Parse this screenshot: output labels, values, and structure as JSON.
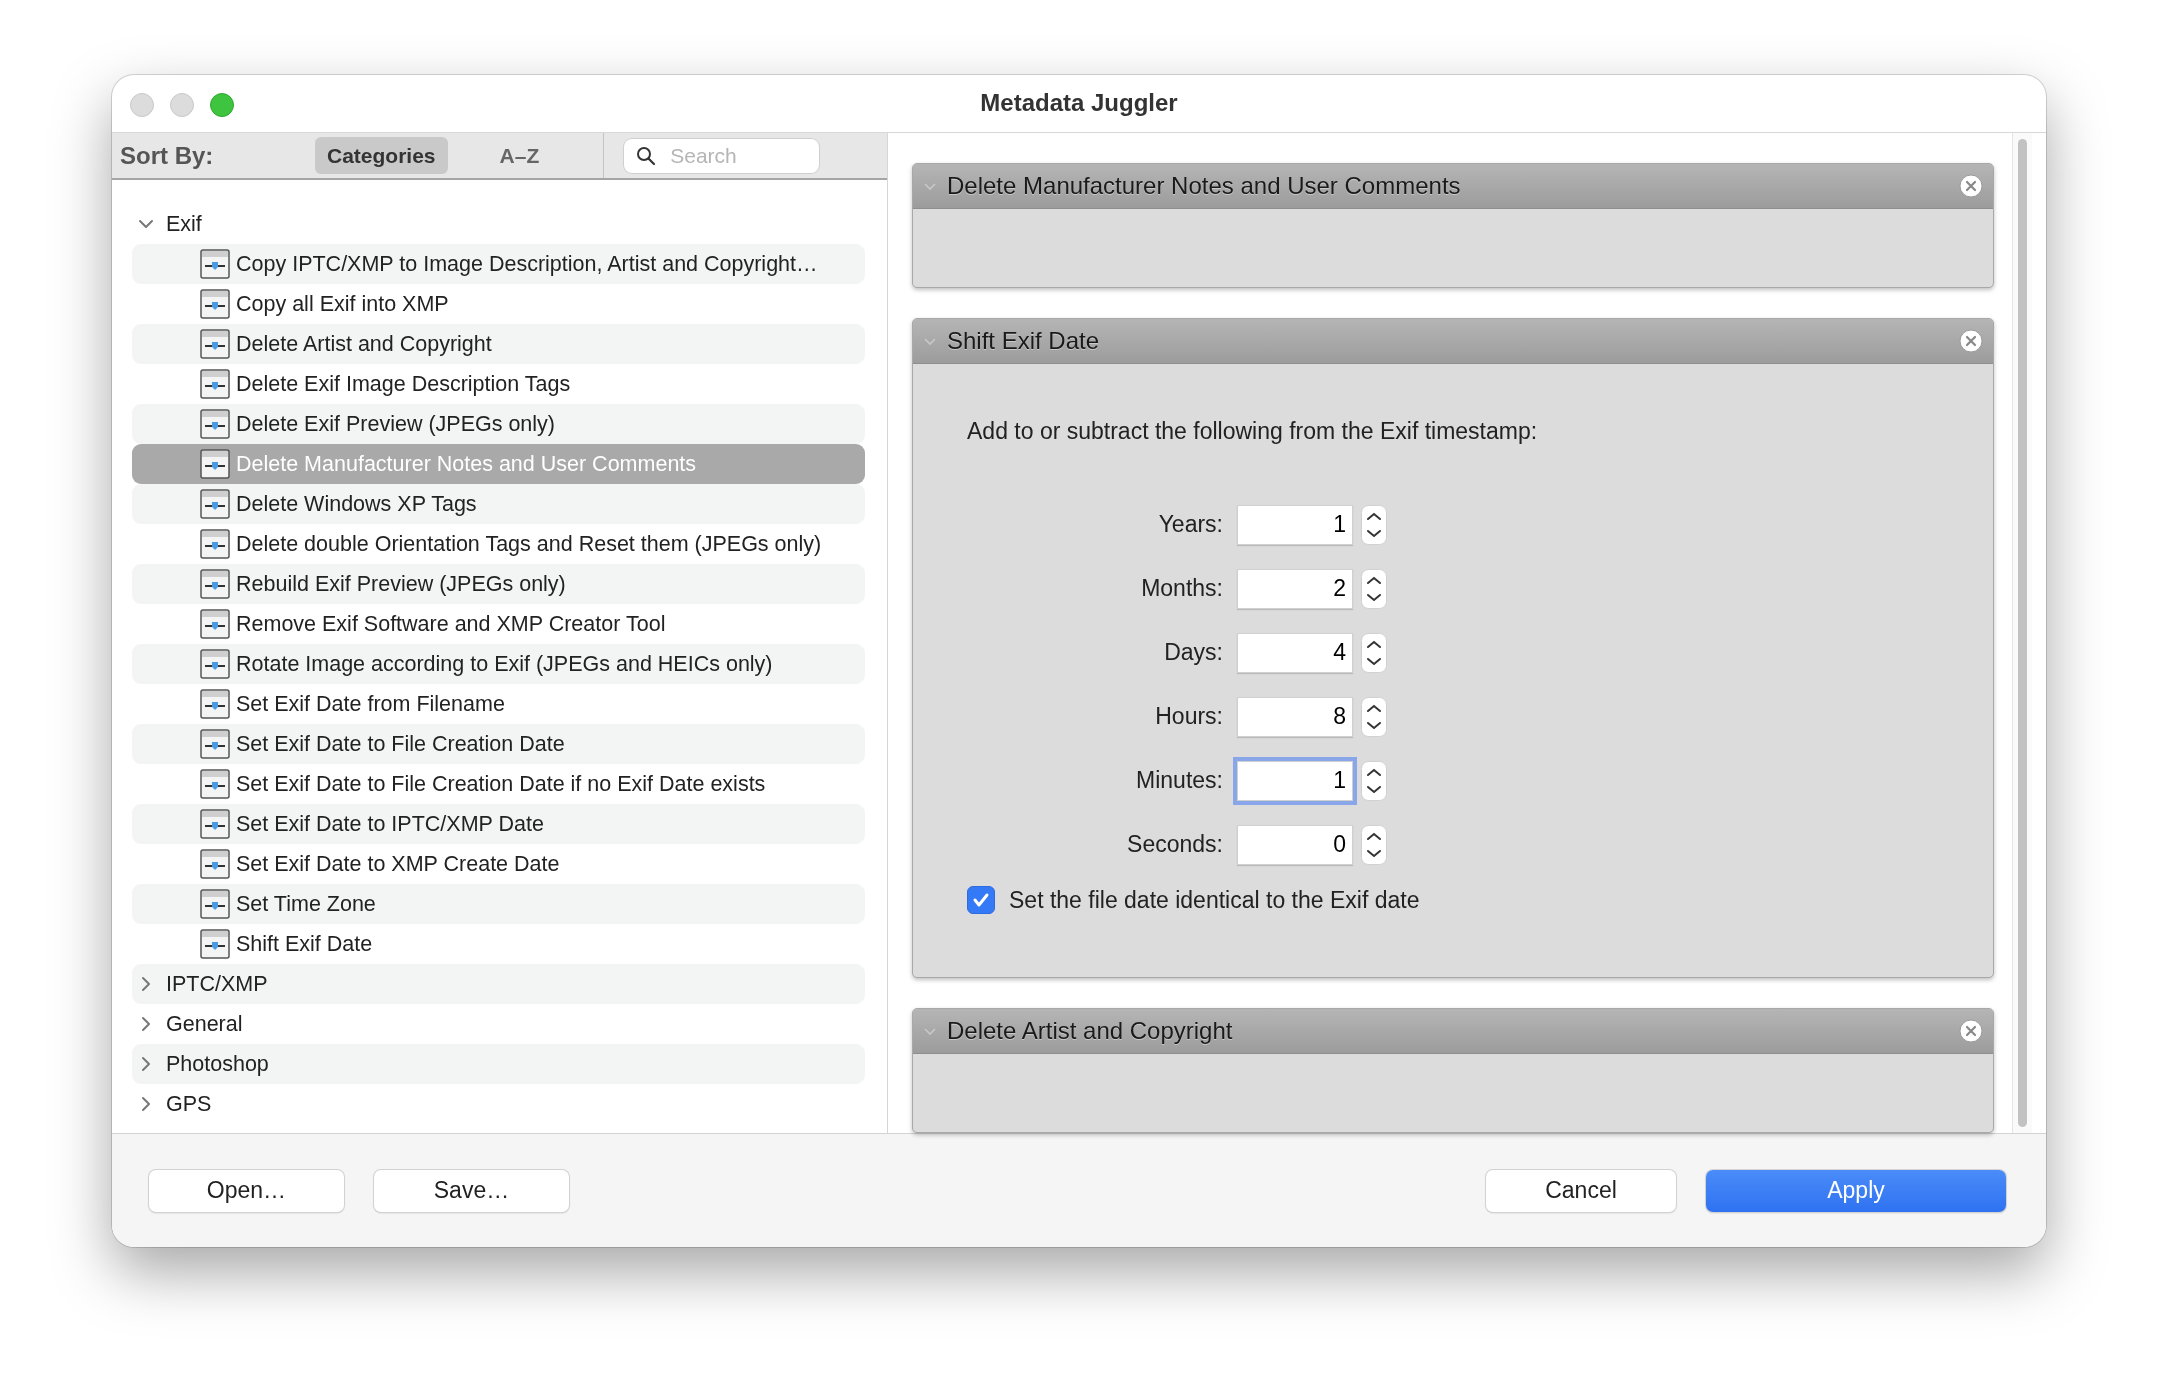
{
  "window": {
    "title": "Metadata Juggler"
  },
  "sort_bar": {
    "label": "Sort By:",
    "options": [
      {
        "label": "Categories",
        "selected": true
      },
      {
        "label": "A–Z",
        "selected": false
      }
    ],
    "search": {
      "placeholder": "Search"
    }
  },
  "tree": [
    {
      "label": "Exif",
      "expanded": true,
      "children": [
        {
          "label": "Copy IPTC/XMP to Image Description, Artist and Copyright…",
          "selected": false
        },
        {
          "label": "Copy all Exif into XMP",
          "selected": false
        },
        {
          "label": "Delete Artist and Copyright",
          "selected": false
        },
        {
          "label": "Delete Exif Image Description Tags",
          "selected": false
        },
        {
          "label": "Delete Exif Preview (JPEGs only)",
          "selected": false
        },
        {
          "label": "Delete Manufacturer Notes and User Comments",
          "selected": true
        },
        {
          "label": "Delete Windows XP Tags",
          "selected": false
        },
        {
          "label": "Delete double Orientation Tags and Reset them (JPEGs only)",
          "selected": false
        },
        {
          "label": "Rebuild Exif Preview (JPEGs only)",
          "selected": false
        },
        {
          "label": "Remove Exif Software and XMP Creator Tool",
          "selected": false
        },
        {
          "label": "Rotate Image according to Exif (JPEGs and HEICs only)",
          "selected": false
        },
        {
          "label": "Set Exif Date from Filename",
          "selected": false
        },
        {
          "label": "Set Exif Date to File Creation Date",
          "selected": false
        },
        {
          "label": "Set Exif Date to File Creation Date if no Exif Date exists",
          "selected": false
        },
        {
          "label": "Set Exif Date to IPTC/XMP Date",
          "selected": false
        },
        {
          "label": "Set Exif Date to XMP Create Date",
          "selected": false
        },
        {
          "label": "Set Time Zone",
          "selected": false
        },
        {
          "label": "Shift Exif Date",
          "selected": false
        }
      ]
    },
    {
      "label": "IPTC/XMP",
      "expanded": false
    },
    {
      "label": "General",
      "expanded": false
    },
    {
      "label": "Photoshop",
      "expanded": false
    },
    {
      "label": "GPS",
      "expanded": false
    }
  ],
  "actions": [
    {
      "title": "Delete Manufacturer Notes and User Comments",
      "kind": "empty"
    },
    {
      "title": "Shift Exif Date",
      "kind": "shift_date",
      "instruction": "Add to or subtract the following from the Exif timestamp:",
      "fields": [
        {
          "label": "Years:",
          "value": "1",
          "focused": false
        },
        {
          "label": "Months:",
          "value": "2",
          "focused": false
        },
        {
          "label": "Days:",
          "value": "4",
          "focused": false
        },
        {
          "label": "Hours:",
          "value": "8",
          "focused": false
        },
        {
          "label": "Minutes:",
          "value": "1",
          "focused": true
        },
        {
          "label": "Seconds:",
          "value": "0",
          "focused": false
        }
      ],
      "checkbox": {
        "label": "Set the file date identical to the Exif date",
        "checked": true
      }
    },
    {
      "title": "Delete Artist and Copyright",
      "kind": "empty"
    }
  ],
  "footer": {
    "left_buttons": [
      "Open…",
      "Save…"
    ],
    "right_buttons": [
      {
        "label": "Cancel",
        "kind": "normal"
      },
      {
        "label": "Apply",
        "kind": "default"
      }
    ]
  }
}
